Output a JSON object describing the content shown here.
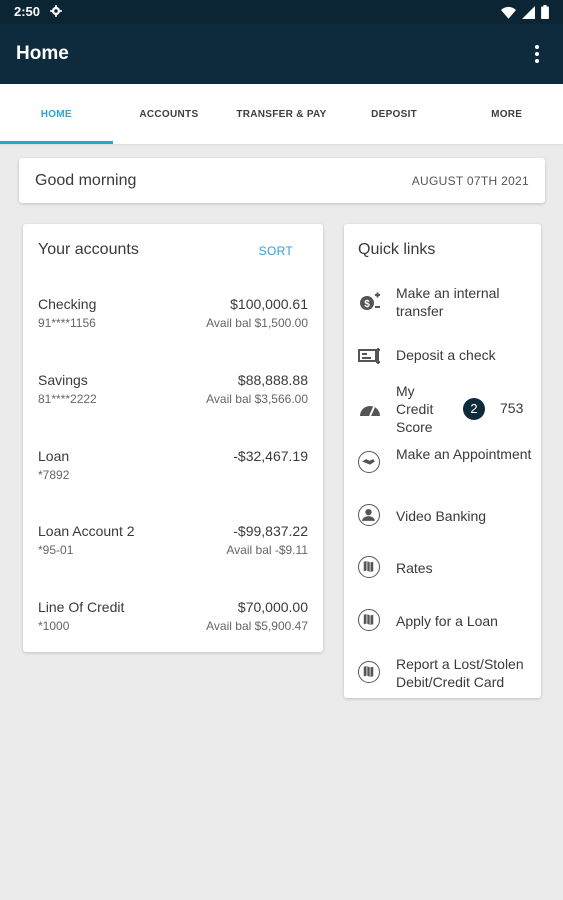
{
  "status_bar": {
    "time": "2:50"
  },
  "app_bar": {
    "title": "Home"
  },
  "tabs": [
    {
      "label": "HOME",
      "active": true
    },
    {
      "label": "ACCOUNTS",
      "active": false
    },
    {
      "label": "TRANSFER & PAY",
      "active": false
    },
    {
      "label": "DEPOSIT",
      "active": false
    },
    {
      "label": "MORE",
      "active": false
    }
  ],
  "greeting": {
    "text": "Good morning",
    "date": "AUGUST 07TH 2021"
  },
  "accounts": {
    "title": "Your accounts",
    "sort_label": "SORT",
    "items": [
      {
        "name": "Checking",
        "number": "91****1156",
        "balance": "$100,000.61",
        "avail": "Avail bal $1,500.00"
      },
      {
        "name": "Savings",
        "number": "81****2222",
        "balance": "$88,888.88",
        "avail": "Avail bal $3,566.00"
      },
      {
        "name": "Loan",
        "number": "*7892",
        "balance": "-$32,467.19",
        "avail": ""
      },
      {
        "name": "Loan Account 2",
        "number": "*95-01",
        "balance": "-$99,837.22",
        "avail": "Avail bal -$9.11"
      },
      {
        "name": "Line Of Credit",
        "number": "*1000",
        "balance": "$70,000.00",
        "avail": "Avail bal $5,900.47"
      }
    ]
  },
  "quick_links": {
    "title": "Quick links",
    "items": [
      {
        "label": "Make an internal transfer",
        "icon": "transfer-icon"
      },
      {
        "label": "Deposit a check",
        "icon": "check-deposit-icon"
      },
      {
        "label": "My Credit Score",
        "icon": "gauge-icon",
        "badge": "2",
        "score": "753"
      },
      {
        "label": "Make an Appointment",
        "icon": "handshake-icon"
      },
      {
        "label": "Video Banking",
        "icon": "person-icon"
      },
      {
        "label": "Rates",
        "icon": "map-icon"
      },
      {
        "label": "Apply for a Loan",
        "icon": "map-icon"
      },
      {
        "label": "Report a Lost/Stolen Debit/Credit Card",
        "icon": "map-icon"
      }
    ]
  },
  "colors": {
    "app_bar": "#0e2b3d",
    "status_bar": "#0b2535",
    "accent": "#2ba3d4",
    "background": "#ebebeb"
  }
}
